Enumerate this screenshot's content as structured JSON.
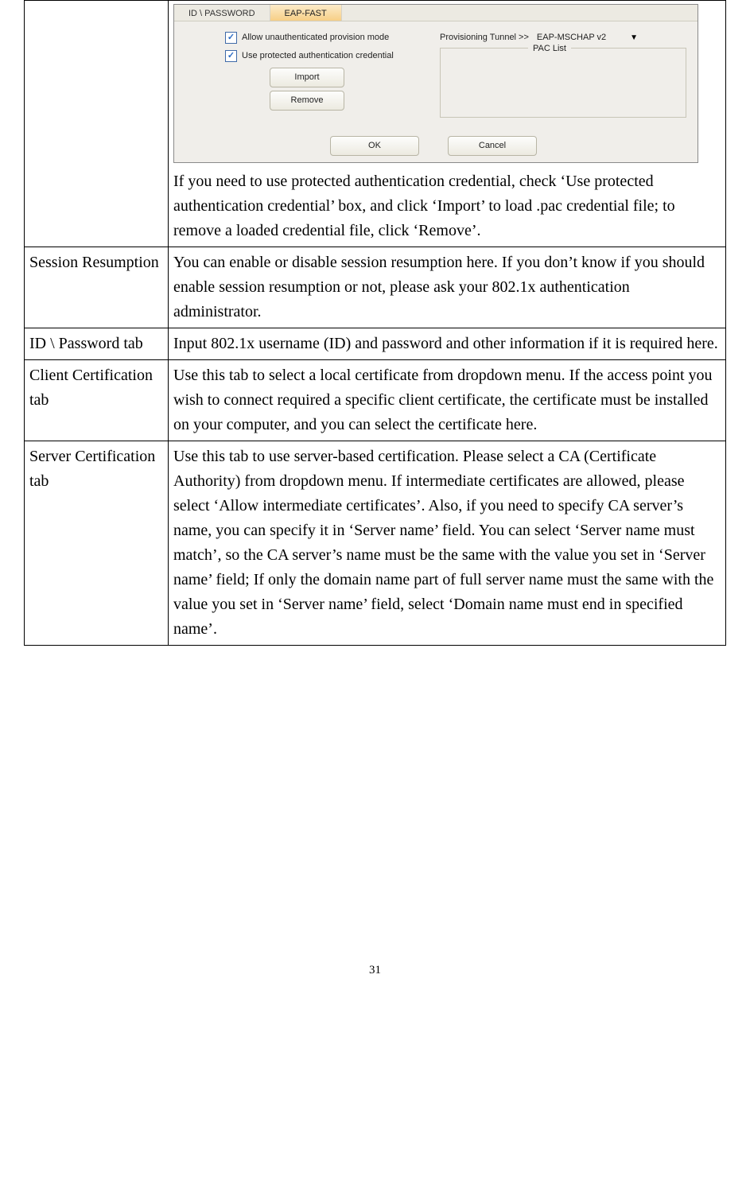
{
  "screenshot": {
    "tabs": {
      "id_password": "ID \\ PASSWORD",
      "eap_fast": "EAP-FAST"
    },
    "chk1": "Allow unauthenticated provision mode",
    "chk2": "Use protected authentication credential",
    "btn_import": "Import",
    "btn_remove": "Remove",
    "prov_label": "Provisioning Tunnel >>",
    "prov_value": "EAP-MSCHAP v2",
    "pac_label": "PAC List",
    "btn_ok": "OK",
    "btn_cancel": "Cancel"
  },
  "row0_text_after": "If you need to use protected authentication credential, check ‘Use protected authentication credential’ box, and click ‘Import’ to load .pac credential file; to remove a loaded credential file, click ‘Remove’.",
  "row1": {
    "label": "Session Resumption",
    "text": "You can enable or disable session resumption here. If you don’t know if you should enable session resumption or not, please ask your 802.1x authentication administrator."
  },
  "row2": {
    "label": "ID \\ Password tab",
    "text": "Input 802.1x username (ID) and password and other information if it is required here."
  },
  "row3": {
    "label": "Client Certification tab",
    "text": "Use this tab to select a local certificate from dropdown menu. If the access point you wish to connect required a specific client certificate, the certificate must be installed on your computer, and you can select the certificate here."
  },
  "row4": {
    "label": "Server Certification tab",
    "text": "Use this tab to use server-based certification. Please select a CA (Certificate Authority) from dropdown menu. If intermediate certificates are allowed, please select ‘Allow intermediate certificates’. Also, if you need to specify CA server’s name, you can specify it in ‘Server name’ field. You can select ‘Server name must match’, so the CA server’s name must be the same with the value you set in ‘Server name’ field; If only the domain name part of full server name must the same with the value you set in ‘Server name’ field, select ‘Domain name must end in specified name’."
  },
  "page_number": "31"
}
